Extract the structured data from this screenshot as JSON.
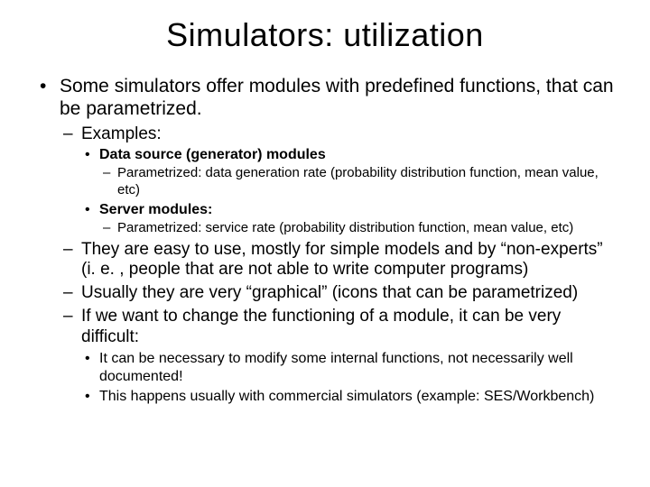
{
  "title": "Simulators: utilization",
  "b1": "Some simulators offer modules with predefined functions, that can be parametrized.",
  "b1_1": "Examples:",
  "b1_1_1": "Data source (generator) modules",
  "b1_1_1_1": "Parametrized: data generation rate (probability distribution function, mean value, etc)",
  "b1_1_2": "Server modules:",
  "b1_1_2_1": "Parametrized: service rate (probability distribution function, mean value, etc)",
  "b1_2": "They are easy to use, mostly for simple models and by “non-experts” (i. e. , people that are not able to write computer programs)",
  "b1_3": "Usually they are very “graphical” (icons that can be parametrized)",
  "b1_4": "If we want to change the functioning of a module, it can be very difficult:",
  "b1_4_1": "It can be necessary to modify some internal functions, not necessarily well documented!",
  "b1_4_2": "This happens usually with commercial simulators (example: SES/Workbench)"
}
